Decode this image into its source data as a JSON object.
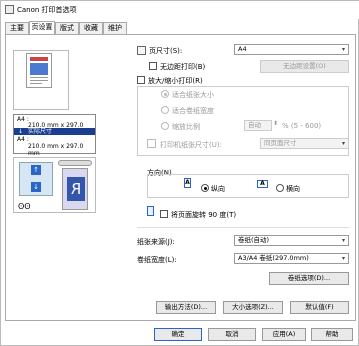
{
  "window": {
    "title": "Canon 打印首选项"
  },
  "tabs": [
    {
      "label": "主要"
    },
    {
      "label": "页设置"
    },
    {
      "label": "版式"
    },
    {
      "label": "收藏"
    },
    {
      "label": "维护"
    }
  ],
  "preview": {
    "size_lines": [
      "A4 :",
      "210.0 mm x 297.0 mm",
      "实际尺寸",
      "A4 :",
      "210.0 mm x 297.0 mm"
    ],
    "feed_label": "R"
  },
  "page_size": {
    "label": "页尺寸(S):",
    "value": "A4"
  },
  "borderless": {
    "label": "无边距打印(B)",
    "button": "无边距设置(O)"
  },
  "scaled": {
    "label": "放大/缩小打印(R)",
    "opt_fit_paper": "适合纸张大小",
    "opt_fit_width": "适合卷纸宽度",
    "opt_scale": "缩放比例",
    "scale_value": "自动",
    "scale_range": "% (5 - 600)",
    "output_label": "打印机纸张尺寸(U):",
    "output_value": "同页面尺寸"
  },
  "orientation": {
    "title": "方向(N)",
    "portrait": "纵向",
    "landscape": "横向"
  },
  "rotate90": {
    "label": "将页面旋转 90 度(T)"
  },
  "paper_source": {
    "label": "纸张来源(J):",
    "value": "卷纸(自动)"
  },
  "roll_width": {
    "label": "卷纸宽度(L):",
    "value": "A3/A4 卷纸(297.0mm)"
  },
  "buttons": {
    "paper_options": "卷纸选项(D)...",
    "output_method": "输出方法(D)...",
    "size_options": "大小选项(Z)...",
    "defaults": "默认值(F)",
    "ok": "确定",
    "cancel": "取消",
    "apply": "应用(A)",
    "help": "帮助"
  }
}
